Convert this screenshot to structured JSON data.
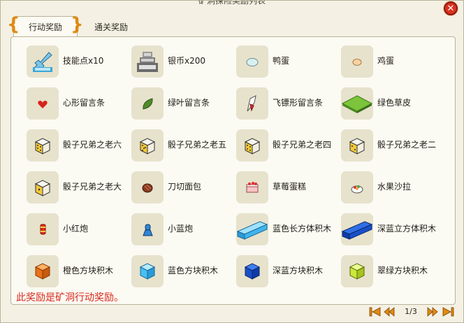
{
  "window": {
    "title": "矿洞探险奖励列表"
  },
  "tabs": [
    {
      "label": "行动奖励",
      "active": true
    },
    {
      "label": "通关奖励",
      "active": false
    }
  ],
  "items": [
    {
      "label": "技能点x10",
      "icon": "skill-points-icon"
    },
    {
      "label": "银币x200",
      "icon": "silver-coin-icon"
    },
    {
      "label": "鸭蛋",
      "icon": "duck-egg-icon"
    },
    {
      "label": "鸡蛋",
      "icon": "chicken-egg-icon"
    },
    {
      "label": "心形留言条",
      "icon": "heart-note-icon"
    },
    {
      "label": "绿叶留言条",
      "icon": "leaf-note-icon"
    },
    {
      "label": "飞镖形留言条",
      "icon": "dart-note-icon"
    },
    {
      "label": "绿色草皮",
      "icon": "grass-tile-icon"
    },
    {
      "label": "骰子兄弟之老六",
      "icon": "dice-icon"
    },
    {
      "label": "骰子兄弟之老五",
      "icon": "dice-icon"
    },
    {
      "label": "骰子兄弟之老四",
      "icon": "dice-icon"
    },
    {
      "label": "骰子兄弟之老二",
      "icon": "dice-icon"
    },
    {
      "label": "骰子兄弟之老大",
      "icon": "dice-icon"
    },
    {
      "label": "刀切面包",
      "icon": "bread-icon"
    },
    {
      "label": "草莓蛋糕",
      "icon": "strawberry-cake-icon"
    },
    {
      "label": "水果沙拉",
      "icon": "fruit-salad-icon"
    },
    {
      "label": "小红炮",
      "icon": "red-cannon-icon"
    },
    {
      "label": "小蓝炮",
      "icon": "blue-cannon-icon"
    },
    {
      "label": "蓝色长方体积木",
      "icon": "blue-cuboid-block-icon"
    },
    {
      "label": "深蓝立方体积木",
      "icon": "dark-blue-cuboid-block-icon"
    },
    {
      "label": "橙色方块积木",
      "icon": "orange-cube-block-icon"
    },
    {
      "label": "蓝色方块积木",
      "icon": "blue-cube-block-icon"
    },
    {
      "label": "深蓝方块积木",
      "icon": "dark-blue-cube-block-icon"
    },
    {
      "label": "翠绿方块积木",
      "icon": "green-cube-block-icon"
    }
  ],
  "footer": {
    "note": "此奖励是矿洞行动奖励。"
  },
  "pager": {
    "current": 1,
    "total": 3,
    "text": "1/3"
  },
  "colors": {
    "accent": "#e08a14",
    "note": "#d9281b",
    "close": "#d8321e"
  }
}
